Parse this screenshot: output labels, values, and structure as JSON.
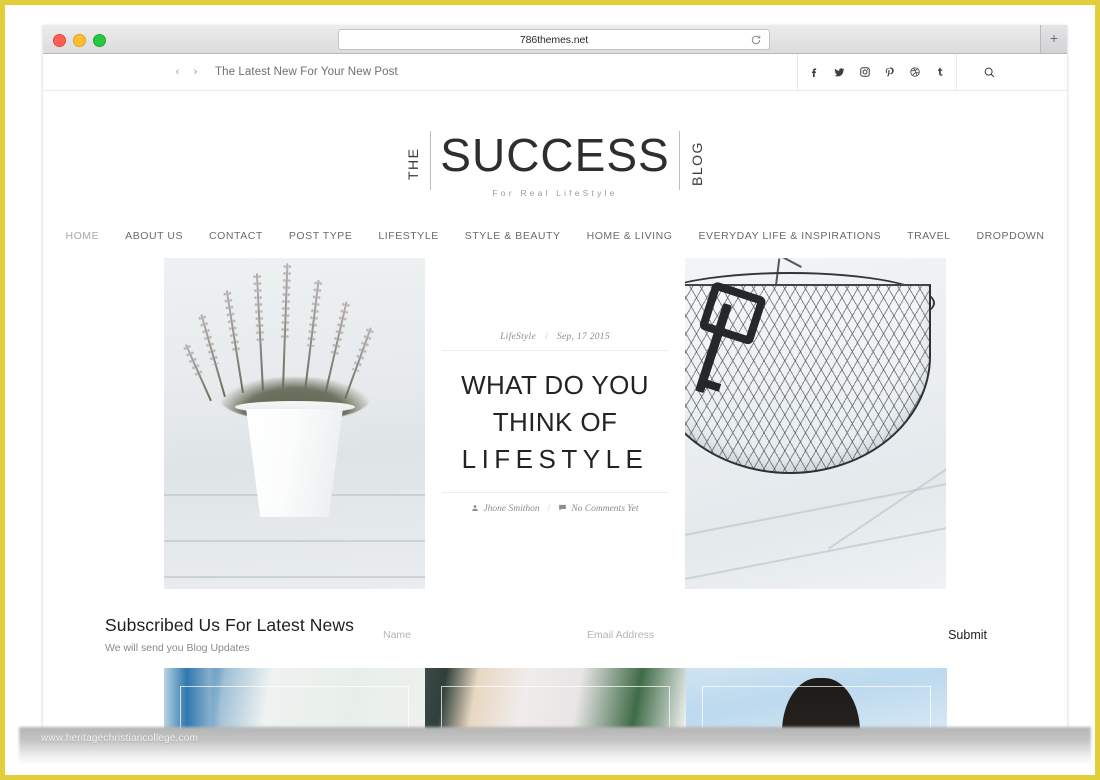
{
  "browser": {
    "url": "786themes.net",
    "reload_icon": "reload-icon",
    "newtab_label": "+",
    "traffic_lights": [
      "close-red",
      "minimize-yellow",
      "maximize-green"
    ]
  },
  "topbar": {
    "prev_arrow": "‹",
    "next_arrow": "›",
    "ticker_text": "The Latest New For Your New Post",
    "social": [
      {
        "name": "facebook-icon",
        "glyph": "f"
      },
      {
        "name": "twitter-icon",
        "glyph": "t"
      },
      {
        "name": "instagram-icon",
        "glyph": "ig"
      },
      {
        "name": "pinterest-icon",
        "glyph": "p"
      },
      {
        "name": "dribbble-icon",
        "glyph": "d"
      },
      {
        "name": "tumblr-icon",
        "glyph": "t"
      }
    ],
    "search_icon": "search-icon"
  },
  "logo": {
    "left_word": "THE",
    "main_word": "SUCCESS",
    "right_word": "BLOG",
    "tagline": "For Real LifeStyle"
  },
  "nav": {
    "items": [
      {
        "label": "HOME",
        "active": true
      },
      {
        "label": "ABOUT US",
        "active": false
      },
      {
        "label": "CONTACT",
        "active": false
      },
      {
        "label": "POST TYPE",
        "active": false
      },
      {
        "label": "LIFESTYLE",
        "active": false
      },
      {
        "label": "STYLE & BEAUTY",
        "active": false
      },
      {
        "label": "HOME & LIVING",
        "active": false
      },
      {
        "label": "EVERYDAY LIFE & INSPIRATIONS",
        "active": false
      },
      {
        "label": "TRAVEL",
        "active": false
      },
      {
        "label": "DROPDOWN",
        "active": false
      }
    ]
  },
  "featured": {
    "left_image_alt": "white potted heather plant on white wooden table",
    "right_image_alt": "black wire mesh basket with vintage key on white wooden planks",
    "category": "LifeStyle",
    "meta_separator": "/",
    "date": "Sep, 17 2015",
    "title_line1": "WHAT DO YOU",
    "title_line2": "THINK OF",
    "title_line3": "LIFESTYLE",
    "author": "Jhone Smithon",
    "byline_separator": "/",
    "comments": "No Comments Yet",
    "author_icon": "user-icon",
    "comments_icon": "comment-icon"
  },
  "subscribe": {
    "title": "Subscribed Us For Latest News",
    "subtitle": "We will send you Blog Updates",
    "name_placeholder": "Name",
    "name_value": "",
    "email_placeholder": "Email Address",
    "email_value": "",
    "submit_label": "Submit"
  },
  "cards": [
    {
      "alt": "person in blue jeans and white knit sweater"
    },
    {
      "alt": "person in white lace dress near green background"
    },
    {
      "alt": "woman with dark hair against blue sky"
    }
  ],
  "watermark": {
    "text": "www.heritagechristiancollege.com"
  },
  "colors": {
    "frame": "#e2cf39",
    "page_background": "#ffffff",
    "text_primary": "#232323",
    "text_muted": "#8d8d8d",
    "nav_text": "#6b6b6b",
    "rule": "#ececec"
  }
}
